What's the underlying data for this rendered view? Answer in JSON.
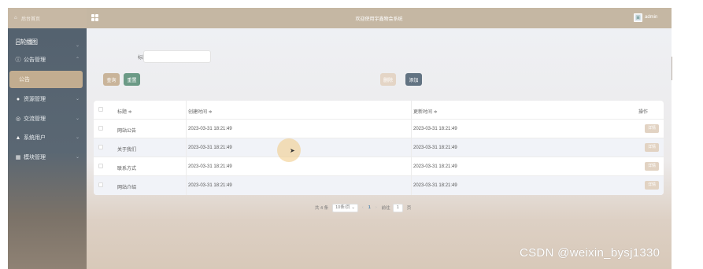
{
  "sidebar": {
    "home": "后台首页",
    "garbled_overlay": "吕轮播图",
    "items": [
      {
        "label": "公告管理",
        "icon": "info-circle-icon",
        "glyph": "ⓘ"
      },
      {
        "label": "资源管理",
        "icon": "location-pin-icon",
        "glyph": "●"
      },
      {
        "label": "交流管理",
        "icon": "chat-bubble-icon",
        "glyph": "◎"
      },
      {
        "label": "系统用户",
        "icon": "user-icon",
        "glyph": "▲"
      },
      {
        "label": "模块管理",
        "icon": "module-grid-icon",
        "glyph": "▦"
      }
    ],
    "active_sub": "公告"
  },
  "topbar": {
    "title": "欢迎使用宇鑫物会系统",
    "user": "admin"
  },
  "search": {
    "label": "标题",
    "placeholder": "",
    "query_label": "查询",
    "reset_label": "重置",
    "delete_label": "删除",
    "add_label": "添加"
  },
  "table": {
    "headers": {
      "title": "标题 ≑",
      "created": "创建时间 ≑",
      "updated": "更新时间 ≑",
      "action": "操作"
    },
    "rows": [
      {
        "title": "网站公告",
        "created": "2023-03-31 18:21:49",
        "updated": "2023-03-31 18:21:49",
        "action": "详情"
      },
      {
        "title": "关于我们",
        "created": "2023-03-31 18:21:49",
        "updated": "2023-03-31 18:21:49",
        "action": "详情"
      },
      {
        "title": "联系方式",
        "created": "2023-03-31 18:21:49",
        "updated": "2023-03-31 18:21:49",
        "action": "详情"
      },
      {
        "title": "网站介绍",
        "created": "2023-03-31 18:21:49",
        "updated": "2023-03-31 18:21:49",
        "action": "详情"
      }
    ]
  },
  "pagination": {
    "total": "共 4 条",
    "page_size": "10条/页",
    "prev": "‹",
    "current": "1",
    "next": "›",
    "goto_label": "前往",
    "goto_value": "1",
    "page_suffix": "页"
  },
  "watermark": "CSDN @weixin_bysj1330",
  "colors": {
    "topbar": "#c5b7a3",
    "sidebar": "#53616e",
    "accent": "#c2ad90"
  }
}
